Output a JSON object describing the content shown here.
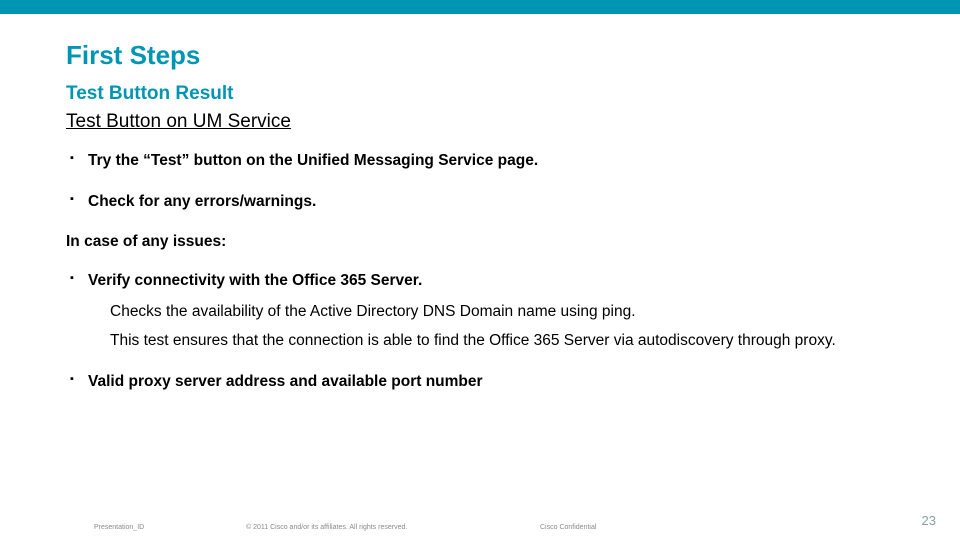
{
  "accent_color": "#0096b3",
  "title": "First Steps",
  "subtitle": "Test Button Result",
  "subheading": "Test Button on UM Service",
  "bullets": [
    {
      "text": "Try the “Test” button on the Unified Messaging Service page."
    },
    {
      "text": "Check for any errors/warnings."
    }
  ],
  "interjection": "In case of any issues:",
  "bullets2": [
    {
      "text": "Verify connectivity with the Office 365 Server.",
      "sub": [
        "Checks the availability of the Active Directory DNS Domain name using ping.",
        "This test ensures that the connection is able to find the Office 365 Server via autodiscovery through proxy."
      ]
    },
    {
      "text": "Valid proxy server address and available port number"
    }
  ],
  "footer": {
    "presentation_id": "Presentation_ID",
    "copyright": "© 2011 Cisco and/or its affiliates. All rights reserved.",
    "confidential": "Cisco Confidential"
  },
  "page_number": "23"
}
